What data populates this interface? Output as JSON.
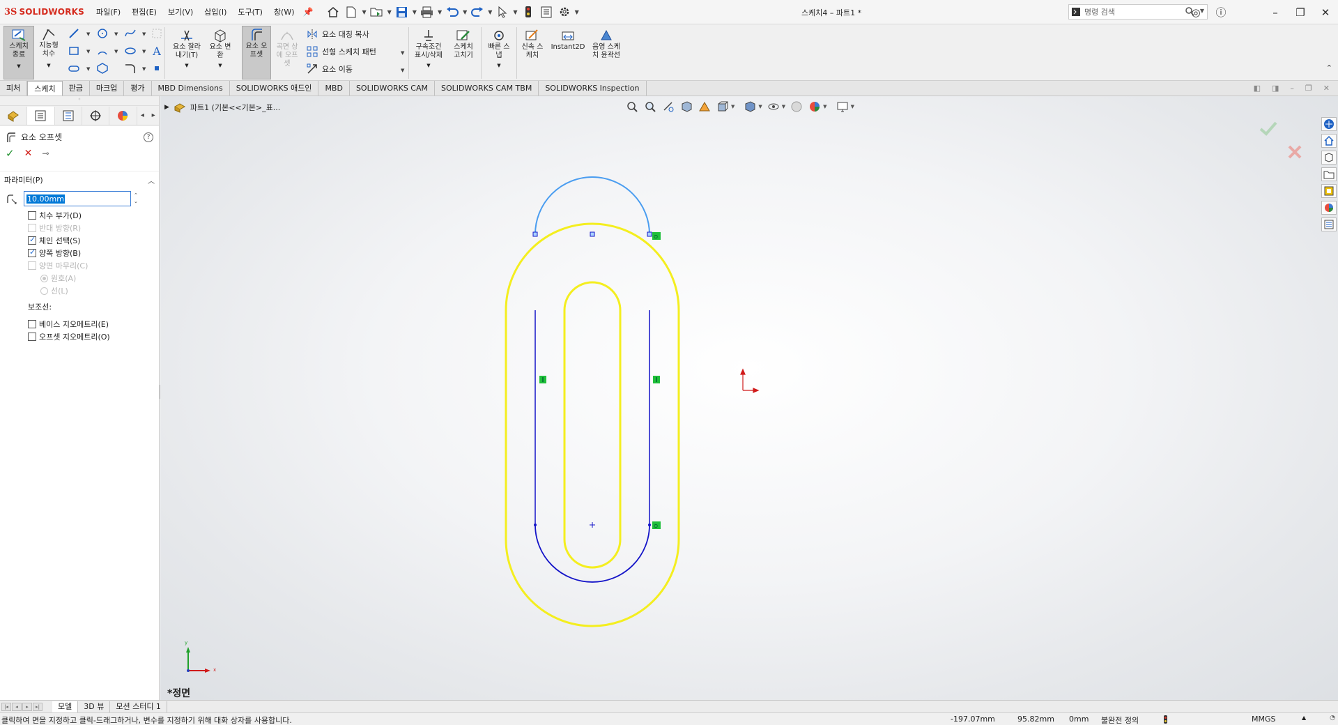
{
  "app": {
    "brand_prefix": "3S",
    "brand": "SOLIDWORKS",
    "doc_title": "스케치4 – 파트1 *"
  },
  "menu": [
    "파일(F)",
    "편집(E)",
    "보기(V)",
    "삽입(I)",
    "도구(T)",
    "창(W)"
  ],
  "search": {
    "placeholder": "명령 검색"
  },
  "toolbar": {
    "exit_sketch": "스케치 종료",
    "smart_dim": "지능형 치수",
    "trim": "요소 잘라내기(T)",
    "convert": "요소 변환",
    "offset": "요소 오프셋",
    "offset_surface": "곡면 상에 오프셋",
    "mirror": "요소 대칭 복사",
    "linear_pattern": "선형 스케치 패턴",
    "move": "요소 이동",
    "relations": "구속조건 표시/삭제",
    "repair": "스케치 고치기",
    "quick_snap": "빠른 스냅",
    "rapid_sketch": "신속 스케치",
    "instant2d": "Instant2D",
    "shaded": "음영 스케치 윤곽선"
  },
  "tabs": [
    "피처",
    "스케치",
    "판금",
    "마크업",
    "평가",
    "MBD Dimensions",
    "SOLIDWORKS 애드인",
    "MBD",
    "SOLIDWORKS CAM",
    "SOLIDWORKS CAM TBM",
    "SOLIDWORKS Inspection"
  ],
  "active_tab": "스케치",
  "property_manager": {
    "title": "요소 오프셋",
    "help": "?",
    "group": "파라미터(P)",
    "distance_value": "10.00mm",
    "options": [
      {
        "label": "치수 부가(D)",
        "checked": false,
        "enabled": true
      },
      {
        "label": "반대 방향(R)",
        "checked": false,
        "enabled": false
      },
      {
        "label": "체인 선택(S)",
        "checked": true,
        "enabled": true
      },
      {
        "label": "양쪽 방향(B)",
        "checked": true,
        "enabled": true
      },
      {
        "label": "양면 마무리(C)",
        "checked": false,
        "enabled": false
      }
    ],
    "cap_options": [
      {
        "label": "원호(A)",
        "selected": true
      },
      {
        "label": "선(L)",
        "selected": false
      }
    ],
    "construction_label": "보조선:",
    "construction_options": [
      {
        "label": "베이스 지오메트리(E)",
        "checked": false
      },
      {
        "label": "오프셋 지오메트리(O)",
        "checked": false
      }
    ]
  },
  "tree": {
    "node": "파트1 (기본<<기본>_표..."
  },
  "viewport": {
    "view_name": "*정면",
    "triad_x": "x",
    "triad_y": "y"
  },
  "bottom_tabs": [
    "모델",
    "3D 뷰",
    "모션 스터디 1"
  ],
  "status": {
    "message": "클릭하여 면을 지정하고 클릭-드래그하거나, 변수를 지정하기 위해 대화 상자를 사용합니다.",
    "x": "-197.07mm",
    "y": "95.82mm",
    "z": "0mm",
    "definition": "불완전 정의",
    "units": "MMGS"
  },
  "colors": {
    "offset_yellow": "#f4ee1f",
    "selected_blue": "#4a9df0",
    "sketch_blue": "#1414c8",
    "relation_green": "#1fbf3a",
    "origin_red": "#d01a1a"
  }
}
